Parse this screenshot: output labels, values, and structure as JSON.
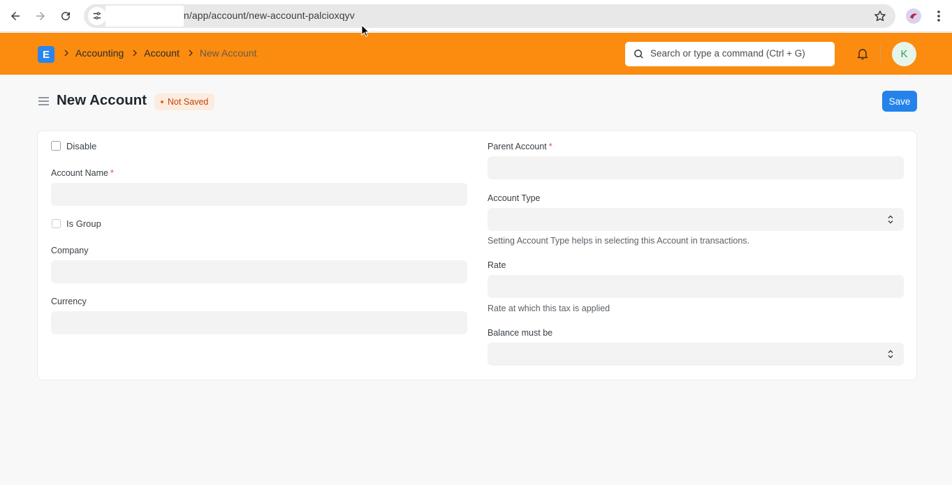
{
  "browser": {
    "url_path": "n/app/account/new-account-palcioxqyv"
  },
  "navbar": {
    "logo_letter": "E",
    "breadcrumbs": [
      "Accounting",
      "Account",
      "New Account"
    ],
    "search_placeholder": "Search or type a command (Ctrl + G)",
    "avatar_initial": "K",
    "accent_color": "#fb8c0f"
  },
  "page": {
    "title": "New Account",
    "status": "Not Saved",
    "save_label": "Save"
  },
  "form": {
    "left": {
      "disable_label": "Disable",
      "account_name_label": "Account Name",
      "account_name_value": "",
      "is_group_label": "Is Group",
      "company_label": "Company",
      "company_value": "",
      "currency_label": "Currency",
      "currency_value": ""
    },
    "right": {
      "parent_account_label": "Parent Account",
      "parent_account_value": "",
      "account_type_label": "Account Type",
      "account_type_value": "",
      "account_type_help": "Setting Account Type helps in selecting this Account in transactions.",
      "rate_label": "Rate",
      "rate_value": "",
      "rate_help": "Rate at which this tax is applied",
      "balance_label": "Balance must be",
      "balance_value": ""
    },
    "required_mark": "*"
  }
}
